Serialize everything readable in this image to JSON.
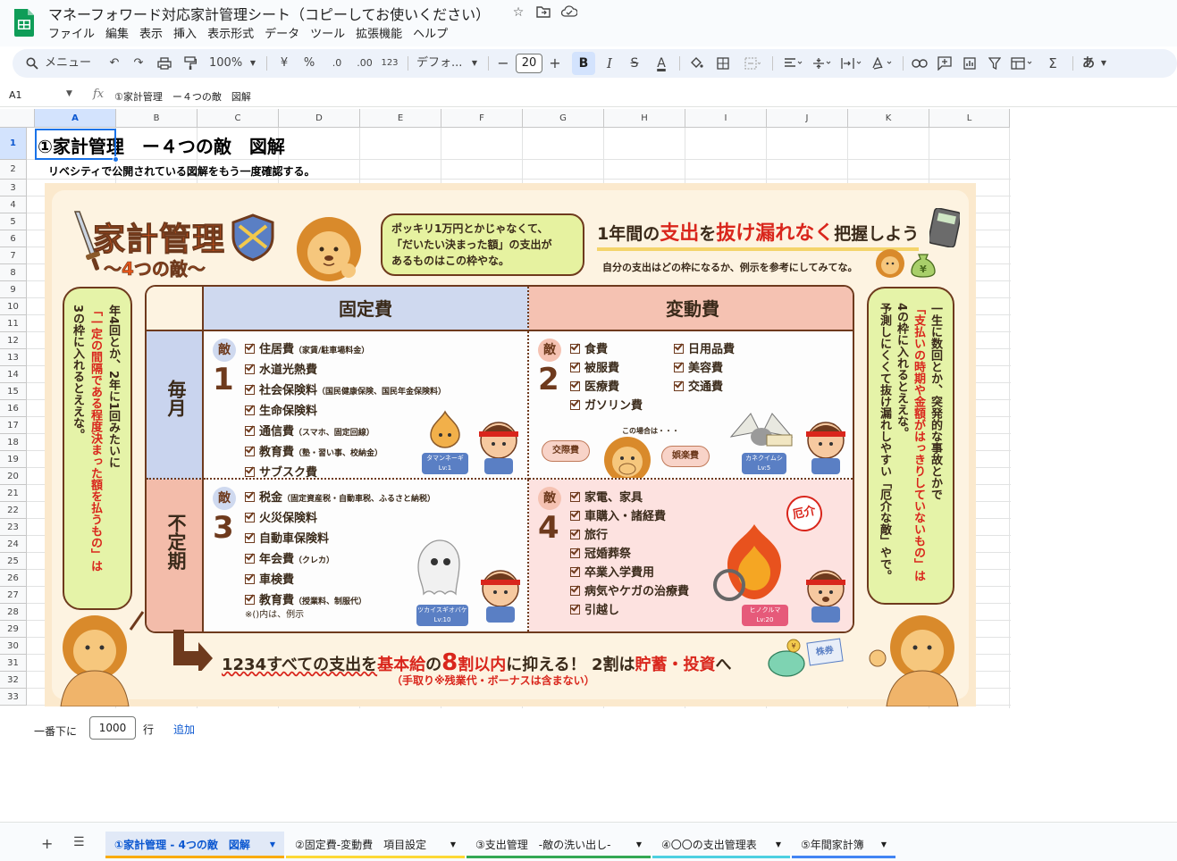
{
  "app": {
    "doc_title": "マネーフォワード対応家計管理シート（コピーしてお使いください）",
    "icons": [
      "star-icon",
      "move-to-folder-icon",
      "cloud-status-icon"
    ]
  },
  "menu": [
    "ファイル",
    "編集",
    "表示",
    "挿入",
    "表示形式",
    "データ",
    "ツール",
    "拡張機能",
    "ヘルプ"
  ],
  "toolbar": {
    "search_label": "メニュー",
    "zoom": "100%",
    "currency": "¥",
    "percent": "%",
    "decrease_decimal": ".0",
    "increase_decimal": ".00",
    "number_format": "123",
    "font_name": "デフォ...",
    "font_size": "20",
    "bold": "B",
    "italic": "I",
    "strike": "S",
    "text_color": "A",
    "input_tools": "あ"
  },
  "formula_bar": {
    "cell_ref": "A1",
    "fx": "fx",
    "value": "①家計管理　ー４つの敵　図解"
  },
  "grid": {
    "columns": [
      "A",
      "B",
      "C",
      "D",
      "E",
      "F",
      "G",
      "H",
      "I",
      "J",
      "K",
      "L"
    ],
    "rows": [
      "1",
      "2",
      "3",
      "4",
      "5",
      "6",
      "7",
      "8",
      "9",
      "10",
      "11",
      "12",
      "13",
      "14",
      "15",
      "16",
      "17",
      "18",
      "19",
      "20",
      "21",
      "22",
      "23",
      "24",
      "25",
      "26",
      "27",
      "28",
      "29",
      "30",
      "31",
      "32",
      "33"
    ],
    "a1": "①家計管理　ー４つの敵　図解",
    "a2": "リベシティで公開されている図解をもう一度確認する。"
  },
  "infographic": {
    "logo_title": "家計管理",
    "logo_sub": "〜4つの敵〜",
    "bubble_text": [
      "ポッキリ1万円とかじゃなくて、",
      "「だいたい決まった額」の支出が",
      "あるものはこの枠やな。"
    ],
    "headline_prefix": "1年間の",
    "headline_em1": "支出",
    "headline_mid": "を",
    "headline_em2": "抜け漏れなく",
    "headline_suffix": "把握しよう",
    "subline": "自分の支出はどの枠になるか、例示を参考にしてみてな。",
    "col_fixed": "固定費",
    "col_variable": "変動費",
    "row_monthly": "毎月",
    "row_irregular": "不定期",
    "enemy_label": "敵",
    "enemy1_num": "1",
    "enemy2_num": "2",
    "enemy3_num": "3",
    "enemy4_num": "4",
    "enemy1_items": [
      {
        "main": "住居費",
        "note": "（家賃/駐車場料金）"
      },
      {
        "main": "水道光熱費",
        "note": ""
      },
      {
        "main": "社会保険料",
        "note": "（国民健康保険、国民年金保険料）"
      },
      {
        "main": "生命保険料",
        "note": ""
      },
      {
        "main": "通信費",
        "note": "（スマホ、固定回線）"
      },
      {
        "main": "教育費",
        "note": "（塾・習い事、校納金）"
      },
      {
        "main": "サブスク費",
        "note": ""
      }
    ],
    "enemy2_items_a": [
      "食費",
      "被服費",
      "医療費",
      "ガソリン費"
    ],
    "enemy2_items_b": [
      "日用品費",
      "美容費",
      "交通費"
    ],
    "enemy2_extra": [
      "交際費",
      "この場合は・・・",
      "娯楽費"
    ],
    "enemy3_items": [
      {
        "main": "税金",
        "note": "（固定資産税・自動車税、ふるさと納税）"
      },
      {
        "main": "火災保険料",
        "note": ""
      },
      {
        "main": "自動車保険料",
        "note": ""
      },
      {
        "main": "年会費",
        "note": "（クレカ）"
      },
      {
        "main": "車検費",
        "note": ""
      },
      {
        "main": "教育費",
        "note": "（授業料、制服代）"
      }
    ],
    "enemy3_footnote": "※()内は、例示",
    "enemy4_items": [
      "家電、家具",
      "車購入・諸経費",
      "旅行",
      "冠婚葬祭",
      "卒業入学費用",
      "病気やケガの治療費",
      "引越し"
    ],
    "monster1": [
      "タマンネーギ",
      "Lv:1"
    ],
    "monster2": [
      "カネクイムシ",
      "Lv:5"
    ],
    "monster3": [
      "ツカイスギオバケ",
      "Lv:10"
    ],
    "monster4": [
      "ヒノクルマ",
      "Lv:20"
    ],
    "danger_badge": "厄介",
    "left_panel_lines": [
      "年4回とか、2年に1回みたいに",
      "「一定の間隔である程度決まった額を払うもの」は",
      "3の枠に入れるとええな。"
    ],
    "right_panel_lines": [
      "一生に数回とか、突発的な事故とかで",
      "「支払いの時期や金額がはっきりしていないもの」は",
      "4の枠に入れるとええな。",
      "予測しにくくて抜け漏れしやすい「厄介な敵」やで。"
    ],
    "bottom_prefix": "1234すべての支出を",
    "bottom_em1": "基本給",
    "bottom_mid1": "の",
    "bottom_em2": "8",
    "bottom_em3": "割以内",
    "bottom_mid2": "に抑える！ 2割は",
    "bottom_em4": "貯蓄・投資",
    "bottom_suffix": "へ",
    "bottom_note": "（手取り※残業代・ボーナスは含まない）",
    "stock_label": "株券",
    "yen_label": "¥",
    "colors": {
      "fixed_header": "#cfd9ef",
      "variable_header": "#f5c2b2",
      "monthly_row": "#c9d4ee",
      "irregular_row": "#f3bcaa",
      "cell_bg": "#fdfdfd",
      "enemy4_bg": "#fde2e0",
      "panel_green": "#e5f3a8",
      "accent_red": "#d9261c",
      "brown": "#6e3a1d"
    }
  },
  "add_rows": {
    "prefix": "一番下に",
    "count": "1000",
    "unit": "行",
    "link": "追加"
  },
  "sheets": [
    {
      "label": "①家計管理 - 4つの敵　図解",
      "color": "#f9ab00"
    },
    {
      "label": "②固定費-変動費　項目設定",
      "color": "#fdd835"
    },
    {
      "label": "③支出管理　-敵の洗い出し-",
      "color": "#34a853"
    },
    {
      "label": "④〇〇の支出管理表",
      "color": "#4dd0e1"
    },
    {
      "label": "⑤年間家計簿",
      "color": "#4285f4"
    }
  ]
}
